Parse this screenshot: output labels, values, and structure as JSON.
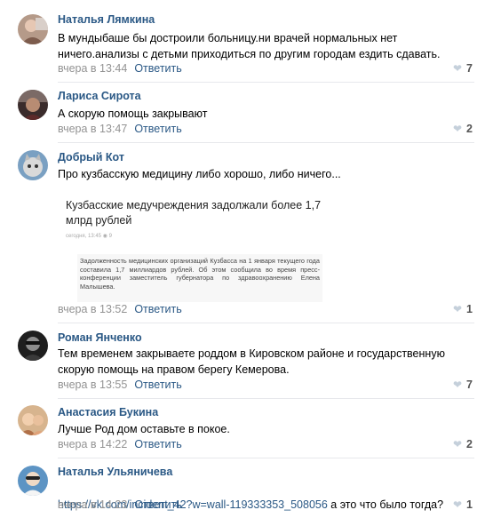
{
  "comments": [
    {
      "author": "Наталья Лямкина",
      "text": "В мундыбаше бы достроили больницу.ни врачей нормальных нет\nничего.анализы с детьми приходиться по другим городам ездить сдавать.",
      "time": "вчера в 13:44",
      "reply": "Ответить",
      "likes": "7",
      "avatar_colors": [
        "#8a6f62",
        "#c9a58e"
      ]
    },
    {
      "author": "Лариса Сирота",
      "text": "А скорую помощь закрывают",
      "time": "вчера в 13:47",
      "reply": "Ответить",
      "likes": "2",
      "avatar_colors": [
        "#5a3b34",
        "#b8937a"
      ]
    },
    {
      "author": "Добрый Кот",
      "text": "Про кузбасскую медицину либо хорошо, либо ничего...",
      "time": "вчера в 13:52",
      "reply": "Ответить",
      "likes": "1",
      "avatar_colors": [
        "#6b8aa8",
        "#e4e4e4"
      ],
      "attachment": {
        "title": "Кузбасские медучреждения задолжали более 1,7 млрд рублей",
        "meta": "сегодня, 13:45   ◉ 9",
        "body": "Задолженность медицинских организаций Кузбасса на 1 января текущего года составила 1,7 миллиардов рублей. Об этом сообщила во время пресс-конференции заместитель губернатора по здравоохранению Елена Малышева."
      }
    },
    {
      "author": "Роман Янченко",
      "text": "Тем временем закрываете роддом в Кировском районе и государственную\nскорую помощь на правом берегу Кемерова.",
      "time": "вчера в 13:55",
      "reply": "Ответить",
      "likes": "7",
      "avatar_colors": [
        "#1a1a1a",
        "#d8d8d8"
      ]
    },
    {
      "author": "Анастасия Букина",
      "text": "Лучше Род дом оставьте в покое.",
      "time": "вчера в 14:22",
      "reply": "Ответить",
      "likes": "2",
      "avatar_colors": [
        "#c98d5c",
        "#f0c8a0"
      ]
    },
    {
      "author": "Наталья Ульяничева",
      "link": "https://vk.com/incident_42?w=wall-119333353_508056",
      "text_after": " а это что было тогда?",
      "time": "вчера в 14:23",
      "reply": "Ответить",
      "likes": "1",
      "avatar_colors": [
        "#4a86b5",
        "#e8d6c4"
      ]
    }
  ],
  "colors": {
    "author": "#2a5885",
    "link": "#2a5885",
    "time": "#939393",
    "heart": "#c5d0db",
    "divider": "#e7e8ec"
  },
  "icons": {
    "like": "heart-icon"
  }
}
